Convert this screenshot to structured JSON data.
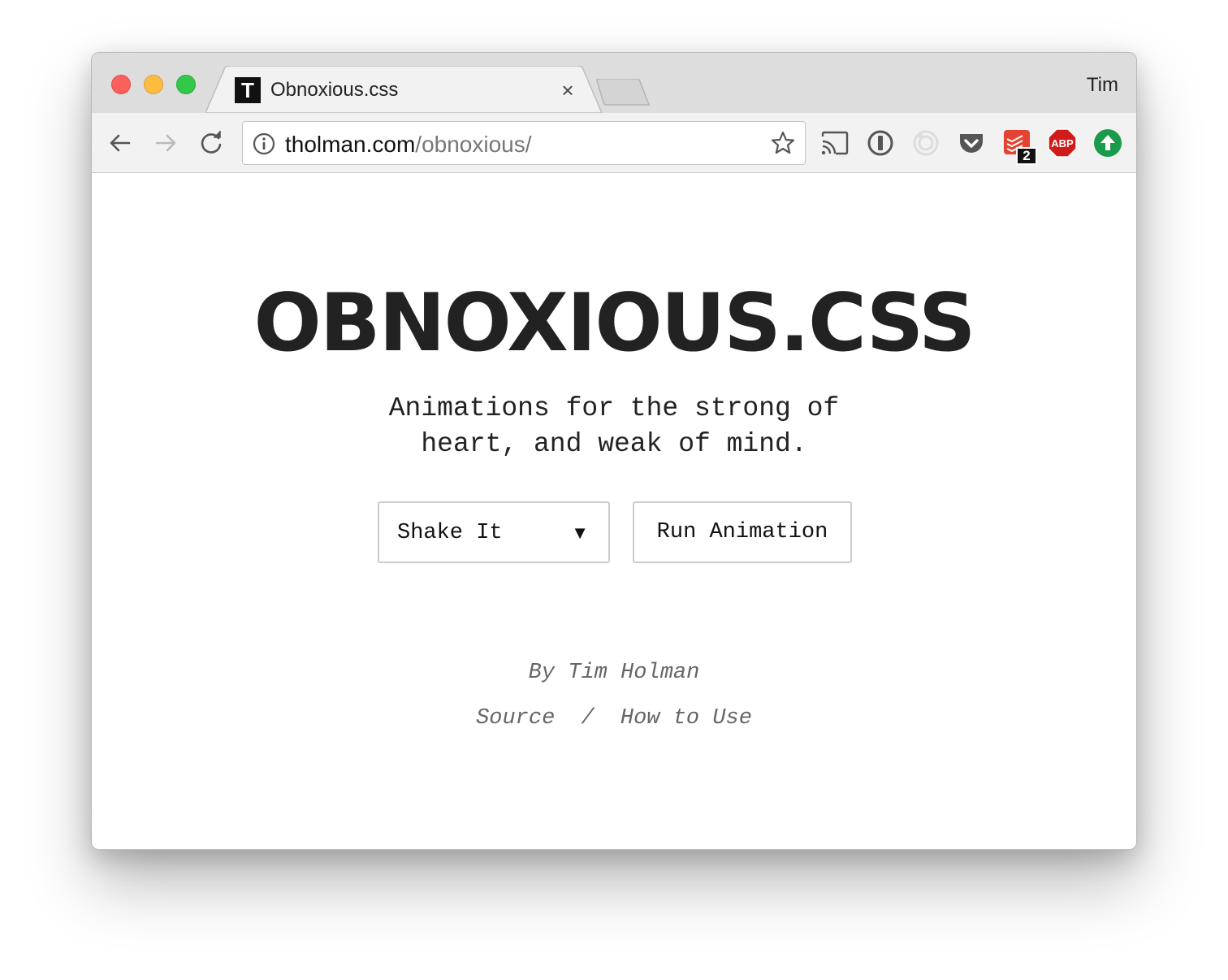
{
  "window": {
    "profile_name": "Tim"
  },
  "tab": {
    "favicon_letter": "T",
    "title": "Obnoxious.css",
    "close_symbol": "×"
  },
  "address_bar": {
    "domain": "tholman.com",
    "path": "/obnoxious/"
  },
  "extensions": {
    "todoist_badge": "2",
    "abp_label": "ABP"
  },
  "page": {
    "headline": "OBNOXIOUS.CSS",
    "tagline_line1": "Animations for the strong of",
    "tagline_line2": "heart, and weak of mind.",
    "animation_select": {
      "selected": "Shake It",
      "arrow": "▼"
    },
    "run_button": "Run Animation",
    "byline": "By Tim Holman",
    "source_link": "Source",
    "separator": "/",
    "howto_link": "How to Use"
  },
  "colors": {
    "traffic_close": "#fc605c",
    "traffic_min": "#fdbc40",
    "traffic_max": "#34c84a",
    "abp_red": "#d11b1b",
    "upload_green": "#1a9a4b",
    "todoist_red": "#e44332"
  }
}
